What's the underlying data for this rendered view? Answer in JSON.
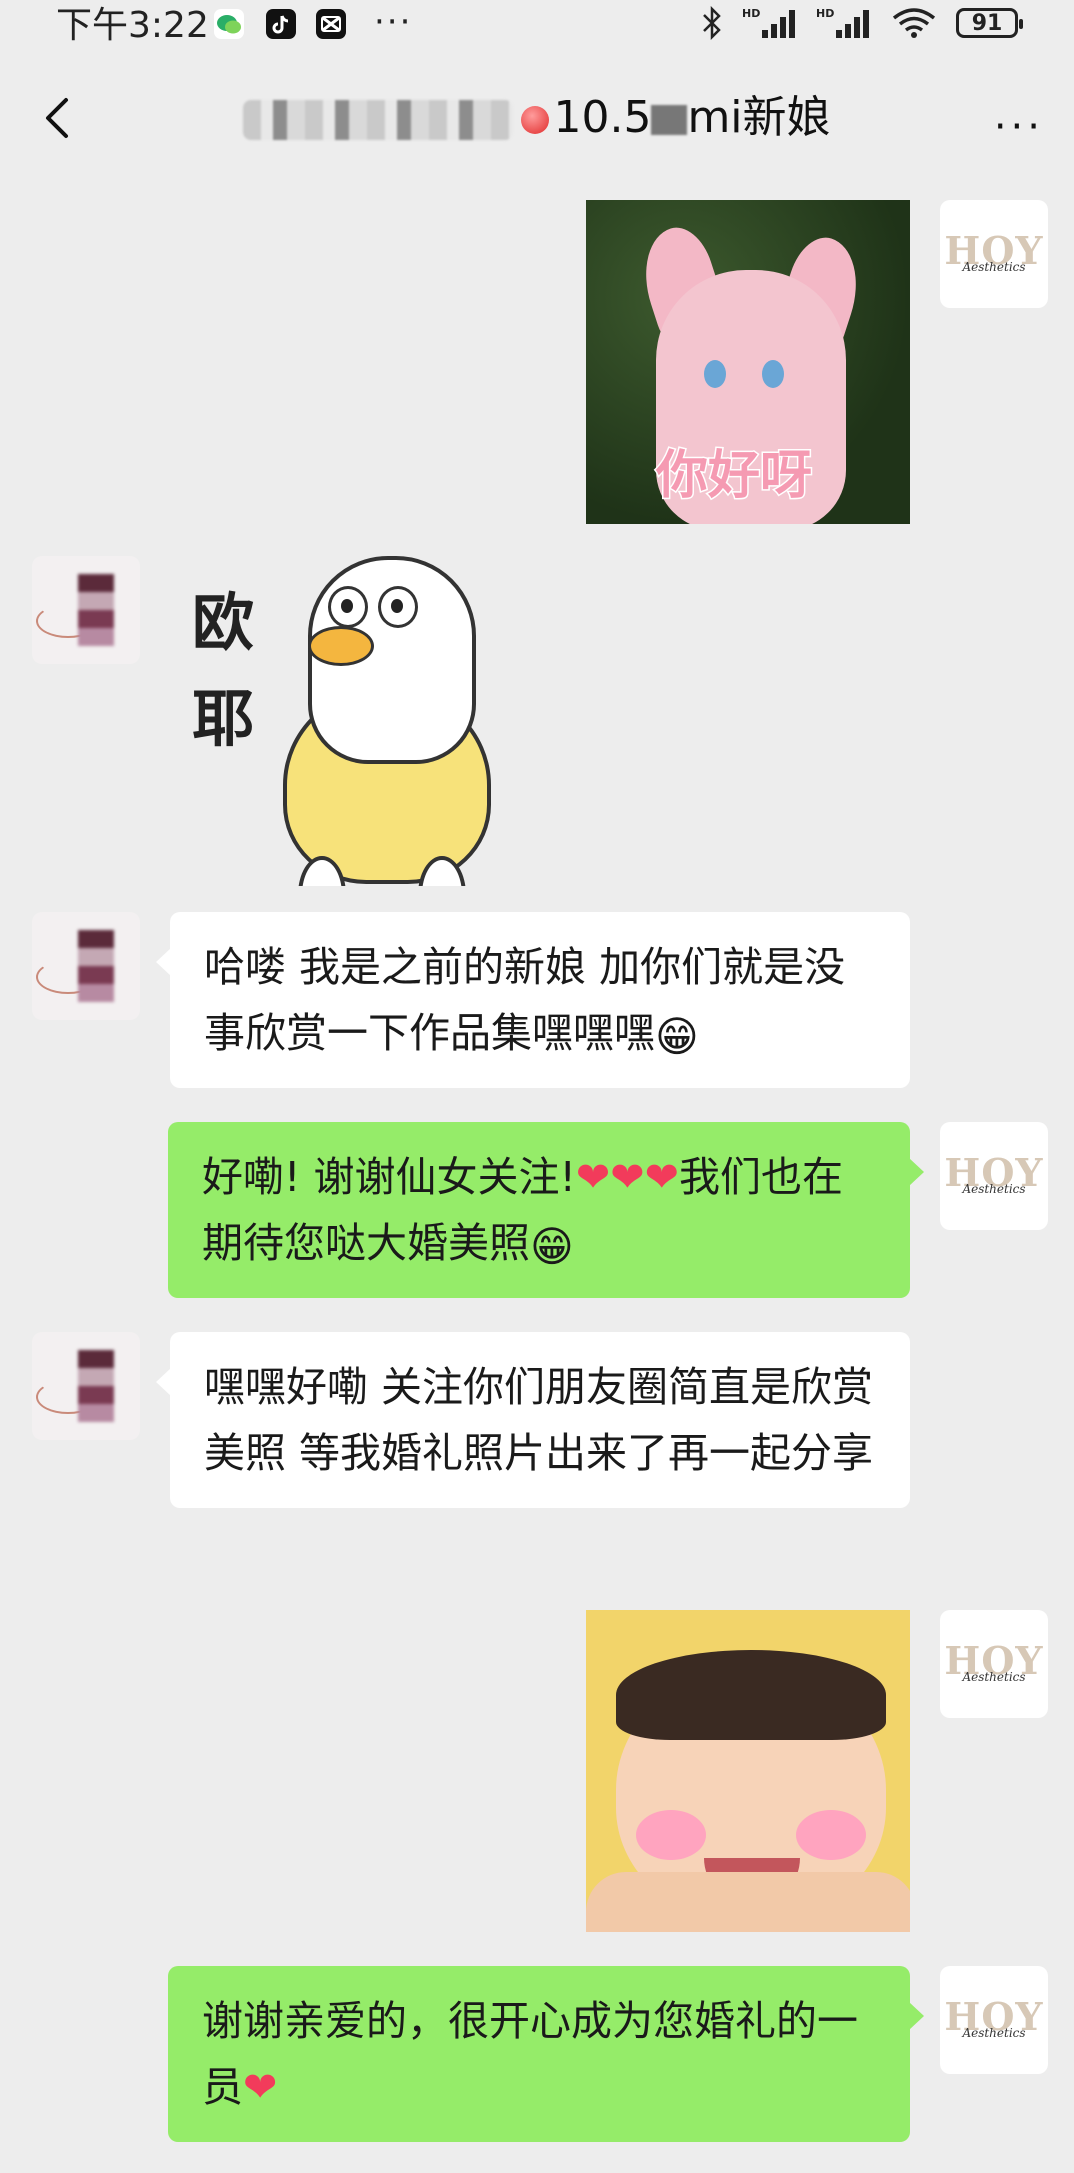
{
  "status_bar": {
    "time": "下午3:22",
    "more": "···",
    "battery": "91"
  },
  "nav": {
    "title_visible": "10.5",
    "title_suffix": "mi新娘",
    "more": "···"
  },
  "avatars": {
    "brand_text": "HOY",
    "brand_sub": "Aesthetics"
  },
  "stickers": {
    "fox_text": "你好呀",
    "duck_text_1": "欧",
    "duck_text_2": "耶"
  },
  "messages": [
    {
      "side": "left",
      "text": "哈喽 我是之前的新娘 加你们就是没事欣赏一下作品集嘿嘿嘿",
      "emoji": "😁"
    },
    {
      "side": "right",
      "text_a": "好嘞! 谢谢仙女关注!",
      "hearts": "❤❤❤",
      "text_b": "我们也在期待您哒大婚美照",
      "emoji": "😁"
    },
    {
      "side": "left",
      "text": "嘿嘿好嘞 关注你们朋友圈简直是欣赏美照  等我婚礼照片出来了再一起分享"
    },
    {
      "side": "right",
      "text": "谢谢亲爱的，很开心成为您婚礼的一员",
      "heart": "❤"
    }
  ],
  "colors": {
    "background": "#ededed",
    "bubble_self": "#95ec69",
    "bubble_other": "#ffffff"
  }
}
